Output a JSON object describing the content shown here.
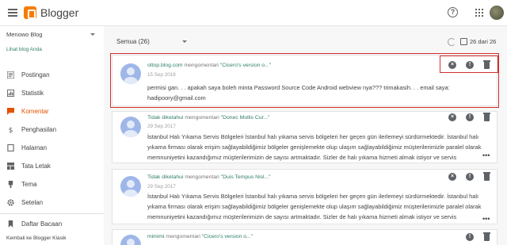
{
  "header": {
    "app_title": "Blogger"
  },
  "sidebar": {
    "blog_name": "Menowo Blog",
    "view_blog": "Lihat blog Anda",
    "items": [
      {
        "label": "Postingan",
        "icon": "postingan-icon"
      },
      {
        "label": "Statistik",
        "icon": "stats-icon"
      },
      {
        "label": "Komentar",
        "icon": "comment-icon",
        "active": true
      },
      {
        "label": "Penghasilan",
        "icon": "dollar-icon"
      },
      {
        "label": "Halaman",
        "icon": "page-icon"
      },
      {
        "label": "Tata Letak",
        "icon": "layout-icon"
      },
      {
        "label": "Tema",
        "icon": "theme-icon"
      },
      {
        "label": "Setelan",
        "icon": "gear-icon"
      }
    ],
    "reading_list": "Daftar Bacaan",
    "classic": "Kembali ke Blogger Klasik"
  },
  "main": {
    "filter": "Semua (26)",
    "count": "26 dari 26",
    "comments": [
      {
        "author": "ottop.blog.com",
        "verb": "mengomentari",
        "post": "\"Cicero's version o...\"",
        "date": "15 Sep 2018",
        "body": "permisi gan. . . apakah saya boleh minta Password Source Code Android webview nya??? trimakasih. . . email saya: hadipoory@gmail.com"
      },
      {
        "author": "Tidak diketahui",
        "verb": "mengomentari",
        "post": "\"Donec Mollis Cur...\"",
        "date": "29 Sep 2017",
        "body": "İstanbul Halı Yıkama Servis Bölgeleri İstanbul halı yıkama servis bölgeleri her geçen gün ilerlemeyi sürdürmektedir. İstanbul halı yıkama firması olarak erişim sağlayabildiğimiz bölgeler genişlemekte olup ulaşım sağlayabildiğimiz müşterilerimizle paralel olarak memnuniyetini kazandığımız müşterilerimizin de sayısı artmaktadır. Sizler de halı yıkama hizmeti almak istiyor ve servis"
      },
      {
        "author": "Tidak diketahui",
        "verb": "mengomentari",
        "post": "\"Duis Tempus Nisl...\"",
        "date": "29 Sep 2017",
        "body": "İstanbul Halı Yıkama Servis Bölgeleri İstanbul halı yıkama servis bölgeleri her geçen gün ilerlemeyi sürdürmektedir. İstanbul halı yıkama firması olarak erişim sağlayabildiğimiz bölgeler genişlemekte olup ulaşım sağlayabildiğimiz müşterilerimizle paralel olarak memnuniyetini kazandığımız müşterilerimizin de sayısı artmaktadır. Sizler de halı yıkama hizmeti almak istiyor ve servis"
      },
      {
        "author": "mimimi",
        "verb": "mengomentari",
        "post": "\"Cicero's version o...\"",
        "date": "",
        "body": ""
      }
    ]
  },
  "colors": {
    "accent": "#e65100",
    "link": "#2e7d6a",
    "highlight": "#d32f2f"
  }
}
